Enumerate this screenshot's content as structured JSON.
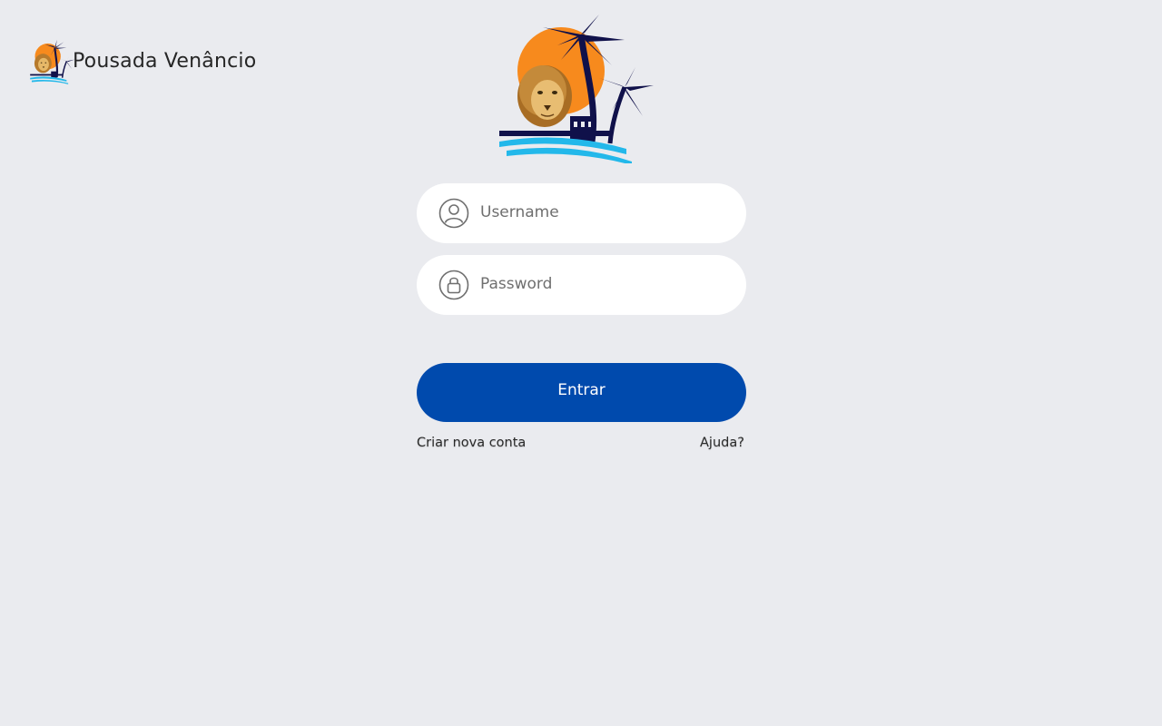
{
  "brand": {
    "name": "Pousada Venâncio",
    "logo_icon": "palm-lion-logo"
  },
  "hero": {
    "logo_icon": "palm-lion-logo"
  },
  "form": {
    "username": {
      "placeholder": "Username",
      "value": "",
      "icon": "user-icon"
    },
    "password": {
      "placeholder": "Password",
      "value": "",
      "icon": "lock-icon"
    },
    "submit_label": "Entrar",
    "create_account_label": "Criar nova conta",
    "help_label": "Ajuda?"
  },
  "colors": {
    "background": "#eaebef",
    "primary": "#004aad",
    "sun": "#f78a1d",
    "palm": "#10114a",
    "wave": "#23b8ea"
  }
}
